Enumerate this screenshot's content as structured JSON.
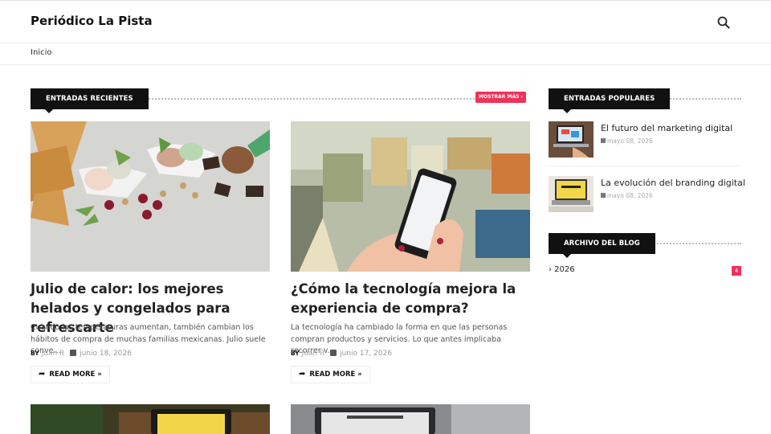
{
  "header": {
    "site_title": "Periódico La Pista",
    "search_icon": "search-icon"
  },
  "menu": {
    "items": [
      "Inicio"
    ]
  },
  "recent": {
    "heading": "ENTRADAS RECIENTES",
    "more_label": "MOSTRAR MÁS ›",
    "posts": [
      {
        "title": "Julio de calor: los mejores helados y congelados para refrescarte",
        "snippet": "Cuando las temperaturas aumentan, también cambian los hábitos de compra de muchas familias mexicanas. Julio suele conve...",
        "by": "BY",
        "author": "Juan R",
        "date": "junio 18, 2026",
        "read_more": "READ MORE »"
      },
      {
        "title": "¿Cómo la tecnología mejora la experiencia de compra?",
        "snippet": "La tecnología ha cambiado la forma en que las personas compran productos y servicios. Lo que antes implicaba recorrer v...",
        "by": "BY",
        "author": "Juan R",
        "date": "junio 17, 2026",
        "read_more": "READ MORE »"
      }
    ]
  },
  "popular": {
    "heading": "ENTRADAS POPULARES",
    "items": [
      {
        "title": "El futuro del marketing digital",
        "date": "mayo 08, 2026"
      },
      {
        "title": "La evolución del branding digital",
        "date": "mayo 08, 2026"
      }
    ]
  },
  "archive": {
    "heading": "ARCHIVO DEL BLOG",
    "entries": [
      {
        "year": "› 2026",
        "count": "4"
      }
    ]
  },
  "colors": {
    "accent": "#f0325a",
    "dark": "#111111"
  }
}
